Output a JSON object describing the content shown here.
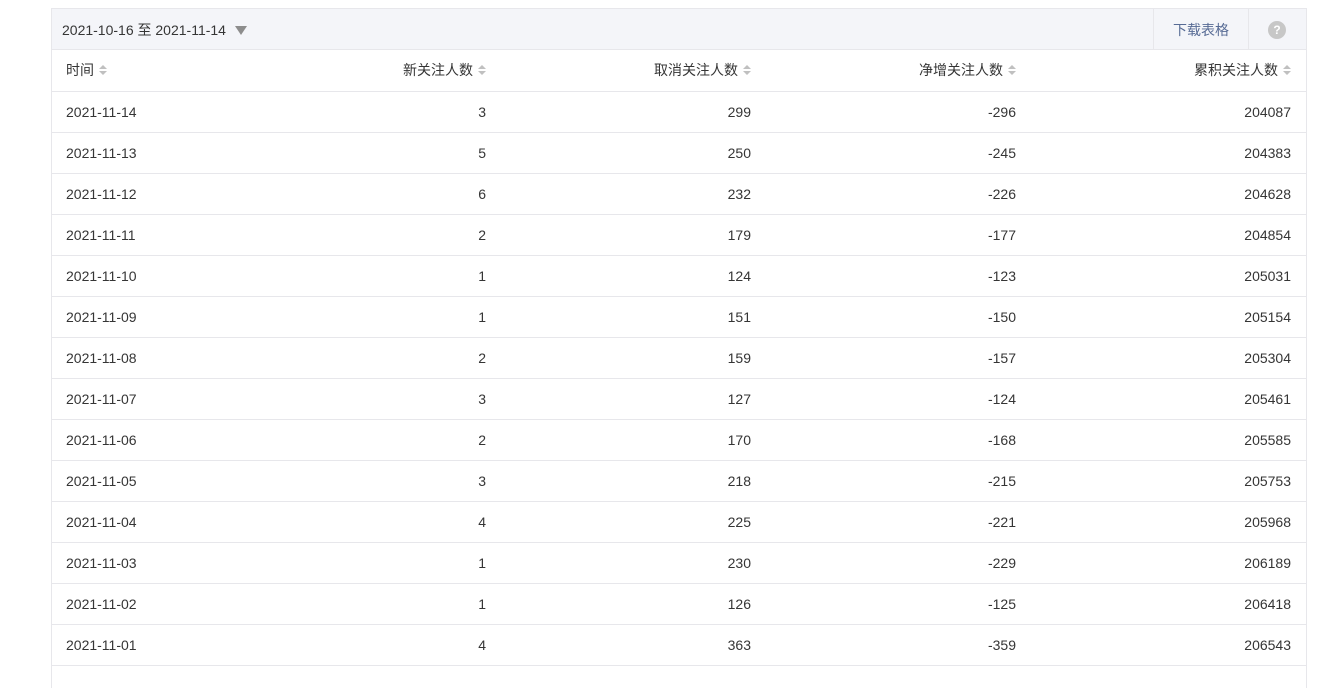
{
  "toolbar": {
    "date_range": "2021-10-16 至 2021-11-14",
    "download_label": "下载表格",
    "help_glyph": "?"
  },
  "table": {
    "columns": [
      "时间",
      "新关注人数",
      "取消关注人数",
      "净增关注人数",
      "累积关注人数"
    ],
    "rows": [
      [
        "2021-11-14",
        "3",
        "299",
        "-296",
        "204087"
      ],
      [
        "2021-11-13",
        "5",
        "250",
        "-245",
        "204383"
      ],
      [
        "2021-11-12",
        "6",
        "232",
        "-226",
        "204628"
      ],
      [
        "2021-11-11",
        "2",
        "179",
        "-177",
        "204854"
      ],
      [
        "2021-11-10",
        "1",
        "124",
        "-123",
        "205031"
      ],
      [
        "2021-11-09",
        "1",
        "151",
        "-150",
        "205154"
      ],
      [
        "2021-11-08",
        "2",
        "159",
        "-157",
        "205304"
      ],
      [
        "2021-11-07",
        "3",
        "127",
        "-124",
        "205461"
      ],
      [
        "2021-11-06",
        "2",
        "170",
        "-168",
        "205585"
      ],
      [
        "2021-11-05",
        "3",
        "218",
        "-215",
        "205753"
      ],
      [
        "2021-11-04",
        "4",
        "225",
        "-221",
        "205968"
      ],
      [
        "2021-11-03",
        "1",
        "230",
        "-229",
        "206189"
      ],
      [
        "2021-11-02",
        "1",
        "126",
        "-125",
        "206418"
      ],
      [
        "2021-11-01",
        "4",
        "363",
        "-359",
        "206543"
      ]
    ]
  },
  "colors": {
    "link": "#576b95",
    "border": "#e7e7eb",
    "toolbar_bg": "#f4f5f9"
  }
}
